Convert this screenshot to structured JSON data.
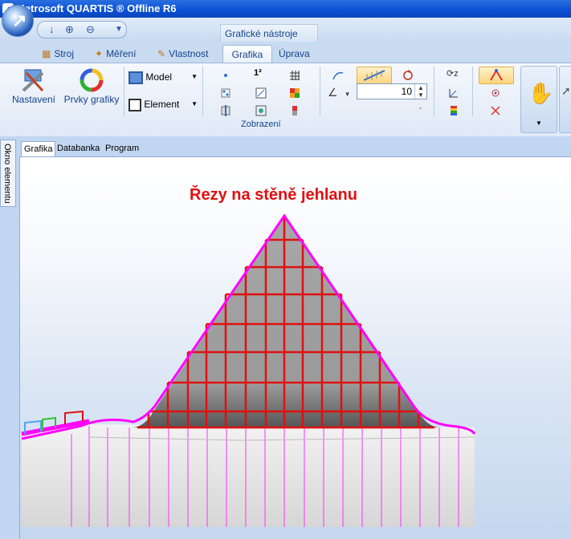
{
  "window": {
    "title": "Metrosoft QUARTIS ® Offline R6"
  },
  "context_tab": "Grafické nástroje",
  "tabs": [
    {
      "label": "Stroj"
    },
    {
      "label": "Měření"
    },
    {
      "label": "Vlastnost"
    },
    {
      "label": "Grafika"
    },
    {
      "label": "Úprava"
    }
  ],
  "ribbon": {
    "nastaveni": "Nastavení",
    "prvky": "Prvky grafiky",
    "model": "Model",
    "element": "Element",
    "spin_value": "10",
    "group_label": "Zobrazení"
  },
  "side_tab": "Okno elementu",
  "doc_tabs": [
    {
      "label": "Grafika"
    },
    {
      "label": "Databanka"
    },
    {
      "label": "Program"
    }
  ],
  "canvas": {
    "caption": "Řezy na stěně jehlanu"
  },
  "colors": {
    "section_lines": "#e01010",
    "contour": "#ff00ff",
    "surface": "#a9a9a9"
  }
}
